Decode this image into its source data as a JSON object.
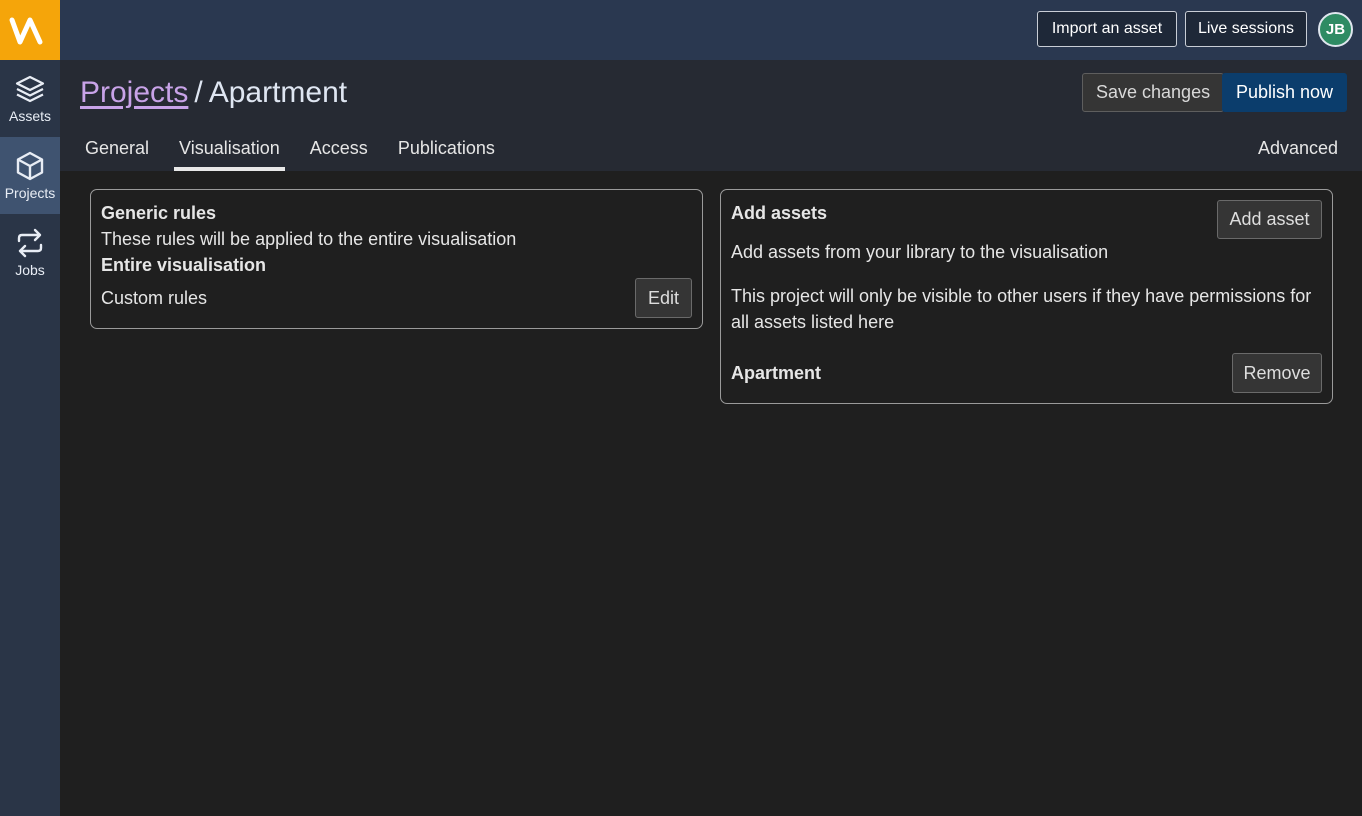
{
  "nav": {
    "items": [
      {
        "label": "Assets",
        "icon": "layers-icon"
      },
      {
        "label": "Projects",
        "icon": "cube-icon",
        "active": true
      },
      {
        "label": "Jobs",
        "icon": "repeat-icon"
      }
    ]
  },
  "topbar": {
    "import_label": "Import an asset",
    "live_label": "Live sessions",
    "avatar_initials": "JB"
  },
  "header": {
    "breadcrumb_link": "Projects",
    "separator": "/",
    "project_name": "Apartment",
    "save_label": "Save changes",
    "publish_label": "Publish now"
  },
  "tabs": {
    "items": [
      "General",
      "Visualisation",
      "Access",
      "Publications"
    ],
    "active": "Visualisation",
    "advanced": "Advanced"
  },
  "generic_rules": {
    "title": "Generic rules",
    "description": "These rules will be applied to the entire visualisation",
    "section": "Entire visualisation",
    "custom_rules": "Custom rules",
    "edit_label": "Edit"
  },
  "add_assets": {
    "title": "Add assets",
    "add_label": "Add asset",
    "description": "Add assets from your library to the visualisation",
    "note": "This project will only be visible to other users if they have permissions for all assets listed here",
    "asset_name": "Apartment",
    "remove_label": "Remove"
  },
  "colors": {
    "logo": "#f5a50a",
    "publish": "#0b3d6c",
    "link": "#c8a3e8",
    "avatar": "#2e8b63"
  }
}
